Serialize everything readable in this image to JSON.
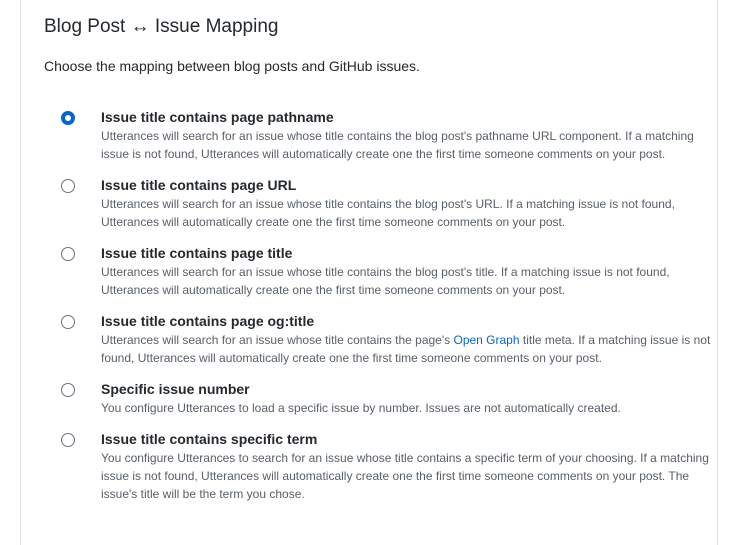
{
  "section": {
    "title": "Blog Post ↔ Issue Mapping",
    "subtitle": "Choose the mapping between blog posts and GitHub issues."
  },
  "options": [
    {
      "label": "Issue title contains page pathname",
      "description": "Utterances will search for an issue whose title contains the blog post's pathname URL component. If a matching issue is not found, Utterances will automatically create one the first time someone comments on your post.",
      "checked": true
    },
    {
      "label": "Issue title contains page URL",
      "description": "Utterances will search for an issue whose title contains the blog post's URL. If a matching issue is not found, Utterances will automatically create one the first time someone comments on your post.",
      "checked": false
    },
    {
      "label": "Issue title contains page title",
      "description": "Utterances will search for an issue whose title contains the blog post's title. If a matching issue is not found, Utterances will automatically create one the first time someone comments on your post.",
      "checked": false
    },
    {
      "label": "Issue title contains page og:title",
      "description_before": "Utterances will search for an issue whose title contains the page's ",
      "description_link": "Open Graph",
      "description_after": " title meta. If a matching issue is not found, Utterances will automatically create one the first time someone comments on your post.",
      "checked": false
    },
    {
      "label": "Specific issue number",
      "description": "You configure Utterances to load a specific issue by number. Issues are not automatically created.",
      "checked": false
    },
    {
      "label": "Issue title contains specific term",
      "description": "You configure Utterances to search for an issue whose title contains a specific term of your choosing. If a matching issue is not found, Utterances will automatically create one the first time someone comments on your post. The issue's title will be the term you chose.",
      "checked": false
    }
  ]
}
